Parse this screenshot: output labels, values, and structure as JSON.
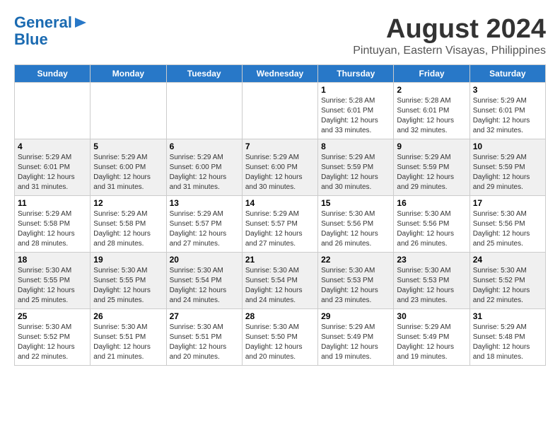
{
  "header": {
    "logo_line1": "General",
    "logo_line2": "Blue",
    "month_title": "August 2024",
    "location": "Pintuyan, Eastern Visayas, Philippines"
  },
  "days_of_week": [
    "Sunday",
    "Monday",
    "Tuesday",
    "Wednesday",
    "Thursday",
    "Friday",
    "Saturday"
  ],
  "weeks": [
    [
      {
        "day": "",
        "info": ""
      },
      {
        "day": "",
        "info": ""
      },
      {
        "day": "",
        "info": ""
      },
      {
        "day": "",
        "info": ""
      },
      {
        "day": "1",
        "info": "Sunrise: 5:28 AM\nSunset: 6:01 PM\nDaylight: 12 hours\nand 33 minutes."
      },
      {
        "day": "2",
        "info": "Sunrise: 5:28 AM\nSunset: 6:01 PM\nDaylight: 12 hours\nand 32 minutes."
      },
      {
        "day": "3",
        "info": "Sunrise: 5:29 AM\nSunset: 6:01 PM\nDaylight: 12 hours\nand 32 minutes."
      }
    ],
    [
      {
        "day": "4",
        "info": "Sunrise: 5:29 AM\nSunset: 6:01 PM\nDaylight: 12 hours\nand 31 minutes."
      },
      {
        "day": "5",
        "info": "Sunrise: 5:29 AM\nSunset: 6:00 PM\nDaylight: 12 hours\nand 31 minutes."
      },
      {
        "day": "6",
        "info": "Sunrise: 5:29 AM\nSunset: 6:00 PM\nDaylight: 12 hours\nand 31 minutes."
      },
      {
        "day": "7",
        "info": "Sunrise: 5:29 AM\nSunset: 6:00 PM\nDaylight: 12 hours\nand 30 minutes."
      },
      {
        "day": "8",
        "info": "Sunrise: 5:29 AM\nSunset: 5:59 PM\nDaylight: 12 hours\nand 30 minutes."
      },
      {
        "day": "9",
        "info": "Sunrise: 5:29 AM\nSunset: 5:59 PM\nDaylight: 12 hours\nand 29 minutes."
      },
      {
        "day": "10",
        "info": "Sunrise: 5:29 AM\nSunset: 5:59 PM\nDaylight: 12 hours\nand 29 minutes."
      }
    ],
    [
      {
        "day": "11",
        "info": "Sunrise: 5:29 AM\nSunset: 5:58 PM\nDaylight: 12 hours\nand 28 minutes."
      },
      {
        "day": "12",
        "info": "Sunrise: 5:29 AM\nSunset: 5:58 PM\nDaylight: 12 hours\nand 28 minutes."
      },
      {
        "day": "13",
        "info": "Sunrise: 5:29 AM\nSunset: 5:57 PM\nDaylight: 12 hours\nand 27 minutes."
      },
      {
        "day": "14",
        "info": "Sunrise: 5:29 AM\nSunset: 5:57 PM\nDaylight: 12 hours\nand 27 minutes."
      },
      {
        "day": "15",
        "info": "Sunrise: 5:30 AM\nSunset: 5:56 PM\nDaylight: 12 hours\nand 26 minutes."
      },
      {
        "day": "16",
        "info": "Sunrise: 5:30 AM\nSunset: 5:56 PM\nDaylight: 12 hours\nand 26 minutes."
      },
      {
        "day": "17",
        "info": "Sunrise: 5:30 AM\nSunset: 5:56 PM\nDaylight: 12 hours\nand 25 minutes."
      }
    ],
    [
      {
        "day": "18",
        "info": "Sunrise: 5:30 AM\nSunset: 5:55 PM\nDaylight: 12 hours\nand 25 minutes."
      },
      {
        "day": "19",
        "info": "Sunrise: 5:30 AM\nSunset: 5:55 PM\nDaylight: 12 hours\nand 25 minutes."
      },
      {
        "day": "20",
        "info": "Sunrise: 5:30 AM\nSunset: 5:54 PM\nDaylight: 12 hours\nand 24 minutes."
      },
      {
        "day": "21",
        "info": "Sunrise: 5:30 AM\nSunset: 5:54 PM\nDaylight: 12 hours\nand 24 minutes."
      },
      {
        "day": "22",
        "info": "Sunrise: 5:30 AM\nSunset: 5:53 PM\nDaylight: 12 hours\nand 23 minutes."
      },
      {
        "day": "23",
        "info": "Sunrise: 5:30 AM\nSunset: 5:53 PM\nDaylight: 12 hours\nand 23 minutes."
      },
      {
        "day": "24",
        "info": "Sunrise: 5:30 AM\nSunset: 5:52 PM\nDaylight: 12 hours\nand 22 minutes."
      }
    ],
    [
      {
        "day": "25",
        "info": "Sunrise: 5:30 AM\nSunset: 5:52 PM\nDaylight: 12 hours\nand 22 minutes."
      },
      {
        "day": "26",
        "info": "Sunrise: 5:30 AM\nSunset: 5:51 PM\nDaylight: 12 hours\nand 21 minutes."
      },
      {
        "day": "27",
        "info": "Sunrise: 5:30 AM\nSunset: 5:51 PM\nDaylight: 12 hours\nand 20 minutes."
      },
      {
        "day": "28",
        "info": "Sunrise: 5:30 AM\nSunset: 5:50 PM\nDaylight: 12 hours\nand 20 minutes."
      },
      {
        "day": "29",
        "info": "Sunrise: 5:29 AM\nSunset: 5:49 PM\nDaylight: 12 hours\nand 19 minutes."
      },
      {
        "day": "30",
        "info": "Sunrise: 5:29 AM\nSunset: 5:49 PM\nDaylight: 12 hours\nand 19 minutes."
      },
      {
        "day": "31",
        "info": "Sunrise: 5:29 AM\nSunset: 5:48 PM\nDaylight: 12 hours\nand 18 minutes."
      }
    ]
  ]
}
